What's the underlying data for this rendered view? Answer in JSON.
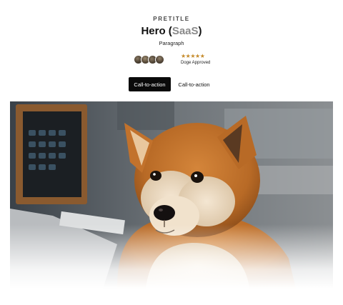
{
  "hero": {
    "pretitle": "PRETITLE",
    "title_main": "Hero (",
    "title_accent": "SaaS",
    "title_end": ")",
    "paragraph": "Paragraph",
    "rating": {
      "stars": "★★★★★",
      "label": "Doge Approved"
    },
    "primary_cta": "Call-to-action",
    "secondary_cta": "Call-to-action"
  }
}
